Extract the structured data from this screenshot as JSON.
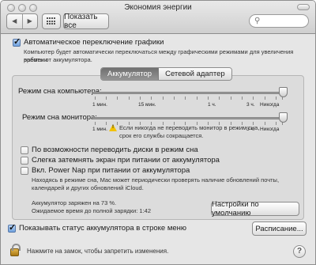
{
  "window": {
    "title": "Экономия энергии"
  },
  "toolbar": {
    "back": "◀",
    "forward": "▶",
    "show_all": "Показать все",
    "search_placeholder": ""
  },
  "graphics_switch": {
    "label": "Автоматическое переключение графики",
    "checked": true,
    "description": [
      "Компьютер будет автоматически переключаться между графическими режимами для увеличения времени",
      "работы от аккумулятора."
    ]
  },
  "tabs": [
    {
      "label": "Аккумулятор",
      "active": true
    },
    {
      "label": "Сетевой адаптер",
      "active": false
    }
  ],
  "sleep_computer": {
    "label": "Режим сна компьютера:",
    "value": "Никогда",
    "scale": [
      "1 мин.",
      "15 мин.",
      "1 ч.",
      "3 ч.",
      "Никогда"
    ]
  },
  "sleep_display": {
    "label": "Режим сна монитора:",
    "value": "Никогда",
    "scale": [
      "1 мин.",
      "15 мин.",
      "1 ч.",
      "3 ч.",
      "Никогда"
    ],
    "warning": [
      "Если никогда не переводить монитор в режим сна,",
      "срок его службы сокращается."
    ]
  },
  "options": [
    {
      "label": "По возможности переводить диски в режим сна",
      "checked": false
    },
    {
      "label": "Слегка затемнять экран при питании от аккумулятора",
      "checked": false
    },
    {
      "label": "Вкл. Power Nap при питании от аккумулятора",
      "checked": false,
      "description": [
        "Находясь в режиме сна, Mac может периодически проверять наличие обновлений почты,",
        "календарей и других обновлений iCloud."
      ]
    }
  ],
  "battery_status": {
    "charge": "Аккумулятор заряжен на 73 %.",
    "time": "Ожидаемое время до полной зарядки: 1:42"
  },
  "defaults_button": "Настройки по умолчанию",
  "menu_status": {
    "label": "Показывать статус аккумулятора в строке меню",
    "checked": true
  },
  "schedule_button": "Расписание...",
  "lock_text": "Нажмите на замок, чтобы запретить изменения.",
  "help": "?"
}
